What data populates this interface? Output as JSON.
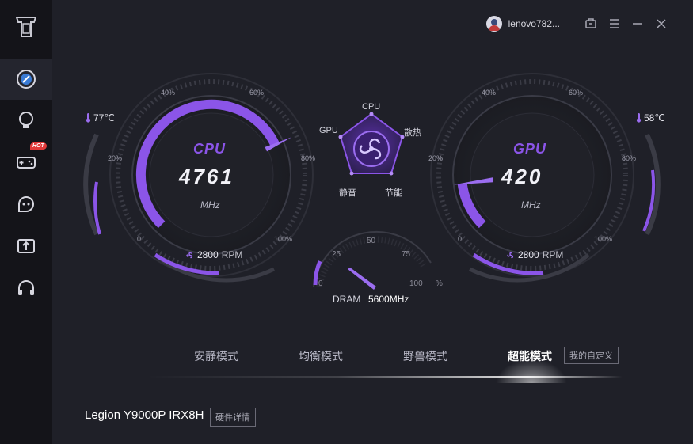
{
  "window": {
    "username": "lenovo782...",
    "controls": [
      "clipboard-icon",
      "menu-icon",
      "minimize-icon",
      "close-icon"
    ]
  },
  "sidebar": {
    "items": [
      {
        "name": "dashboard",
        "icon": "speedometer-icon",
        "active": true
      },
      {
        "name": "lighting",
        "icon": "bulb-icon"
      },
      {
        "name": "games",
        "icon": "gamepad-icon",
        "badge": "HOT"
      },
      {
        "name": "assistant",
        "icon": "chat-face-icon"
      },
      {
        "name": "upload",
        "icon": "upload-icon"
      },
      {
        "name": "audio",
        "icon": "headset-icon"
      }
    ]
  },
  "cpu": {
    "name": "CPU",
    "value": "4761",
    "unit": "MHz",
    "temp": "77℃",
    "fan": "2800",
    "fan_unit": "RPM",
    "ticks": [
      "0",
      "20%",
      "40%",
      "60%",
      "80%",
      "100%"
    ],
    "load_fraction": 0.74
  },
  "gpu": {
    "name": "GPU",
    "value": "420",
    "unit": "MHz",
    "temp": "58℃",
    "fan": "2800",
    "fan_unit": "RPM",
    "ticks": [
      "0",
      "20%",
      "40%",
      "60%",
      "80%",
      "100%"
    ],
    "load_fraction": 0.14
  },
  "radar": {
    "labels": {
      "top": "CPU",
      "left": "GPU",
      "right": "散热",
      "bottom_left": "静音",
      "bottom_right": "节能"
    }
  },
  "dram": {
    "label": "DRAM",
    "value": "5600MHz",
    "ticks": [
      "0",
      "25",
      "50",
      "75",
      "100"
    ],
    "unit": "%",
    "usage_fraction": 0.05
  },
  "modes": {
    "items": [
      "安静模式",
      "均衡模式",
      "野兽模式",
      "超能模式"
    ],
    "active": "超能模式",
    "custom": "我的自定义"
  },
  "device": {
    "model": "Legion Y9000P IRX8H",
    "details_button": "硬件详情"
  },
  "colors": {
    "accent": "#8b55e8",
    "background": "#1f2028",
    "sidebar": "#141419"
  }
}
